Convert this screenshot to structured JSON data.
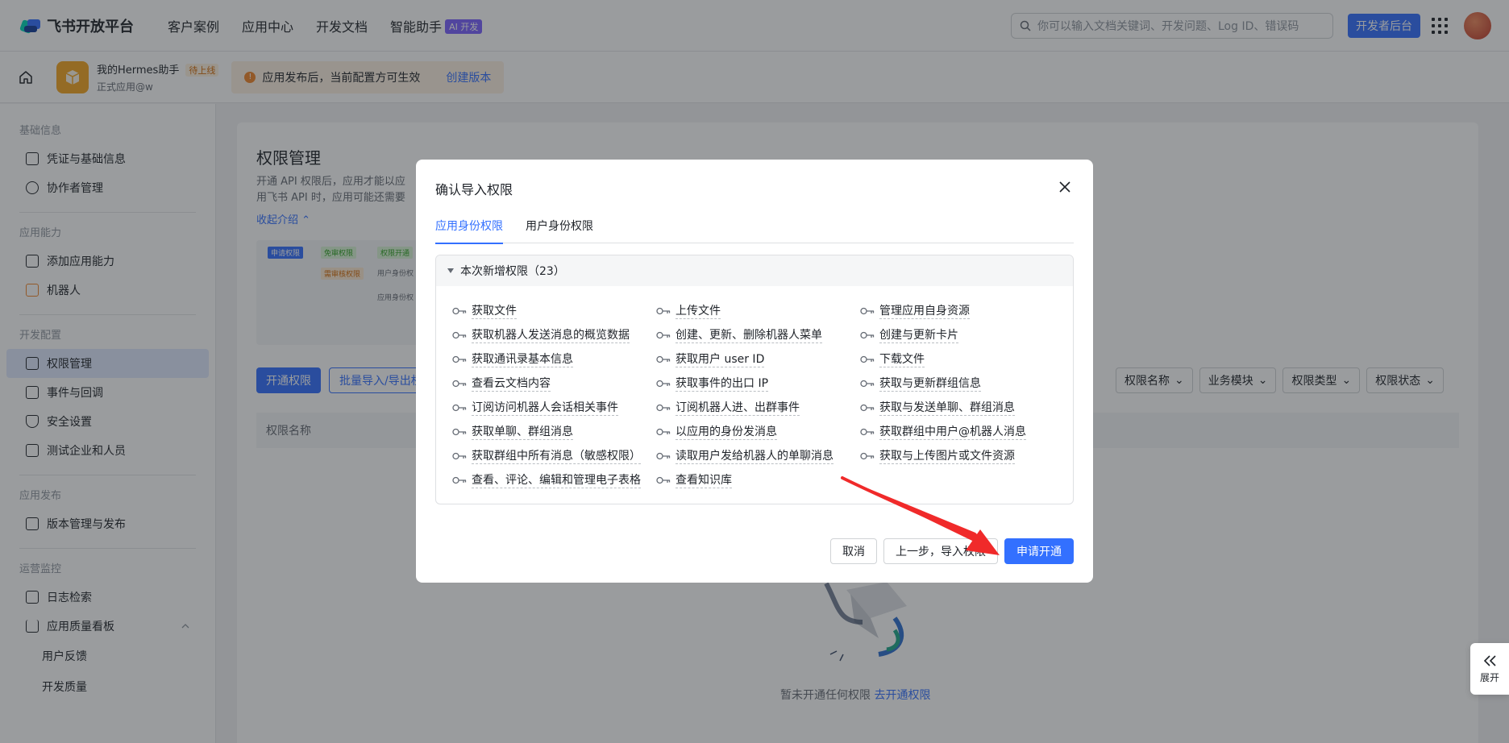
{
  "nav": {
    "brand": "飞书开放平台",
    "items": [
      "客户案例",
      "应用中心",
      "开发文档",
      "智能助手"
    ],
    "ai_badge": "AI 开发",
    "search_placeholder": "你可以输入文档关键词、开发问题、Log ID、错误码",
    "dev_console": "开发者后台"
  },
  "app": {
    "name": "我的Hermes助手",
    "status": "待上线",
    "sub": "正式应用@w",
    "notice": "应用发布后，当前配置方可生效",
    "notice_link": "创建版本"
  },
  "sidebar": {
    "groups": [
      {
        "title": "基础信息",
        "items": [
          "凭证与基础信息",
          "协作者管理"
        ]
      },
      {
        "title": "应用能力",
        "items": [
          "添加应用能力",
          "机器人"
        ]
      },
      {
        "title": "开发配置",
        "items": [
          "权限管理",
          "事件与回调",
          "安全设置",
          "测试企业和人员"
        ]
      },
      {
        "title": "应用发布",
        "items": [
          "版本管理与发布"
        ]
      },
      {
        "title": "运营监控",
        "items": [
          "日志检索",
          "应用质量看板"
        ]
      }
    ],
    "sub_items": [
      "用户反馈",
      "开发质量"
    ]
  },
  "main": {
    "title": "权限管理",
    "desc1": "开通 API 权限后，应用才能以应",
    "desc2": "用飞书 API 时，应用可能还需要",
    "collapse": "收起介绍",
    "flow": [
      "申请权限",
      "免审权限",
      "权限开通",
      "需审核权限",
      "用户身份权",
      "应用身份权"
    ],
    "btn_open": "开通权限",
    "btn_batch": "批量导入/导出权",
    "filters": [
      "权限名称",
      "业务模块",
      "权限类型",
      "权限状态"
    ],
    "col_name": "权限名称",
    "empty": "暂未开通任何权限",
    "empty_link": "去开通权限"
  },
  "modal": {
    "title": "确认导入权限",
    "tabs": [
      "应用身份权限",
      "用户身份权限"
    ],
    "section": "本次新增权限（23）",
    "permissions": [
      "获取文件",
      "上传文件",
      "管理应用自身资源",
      "获取机器人发送消息的概览数据",
      "创建、更新、删除机器人菜单",
      "创建与更新卡片",
      "获取通讯录基本信息",
      "获取用户 user ID",
      "下载文件",
      "查看云文档内容",
      "获取事件的出口 IP",
      "获取与更新群组信息",
      "订阅访问机器人会话相关事件",
      "订阅机器人进、出群事件",
      "获取与发送单聊、群组消息",
      "获取单聊、群组消息",
      "以应用的身份发消息",
      "获取群组中用户@机器人消息",
      "获取群组中所有消息（敏感权限）",
      "读取用户发给机器人的单聊消息",
      "获取与上传图片或文件资源",
      "查看、评论、编辑和管理电子表格",
      "查看知识库"
    ],
    "cancel": "取消",
    "prev": "上一步，导入权限",
    "submit": "申请开通"
  },
  "expand_label": "展开"
}
